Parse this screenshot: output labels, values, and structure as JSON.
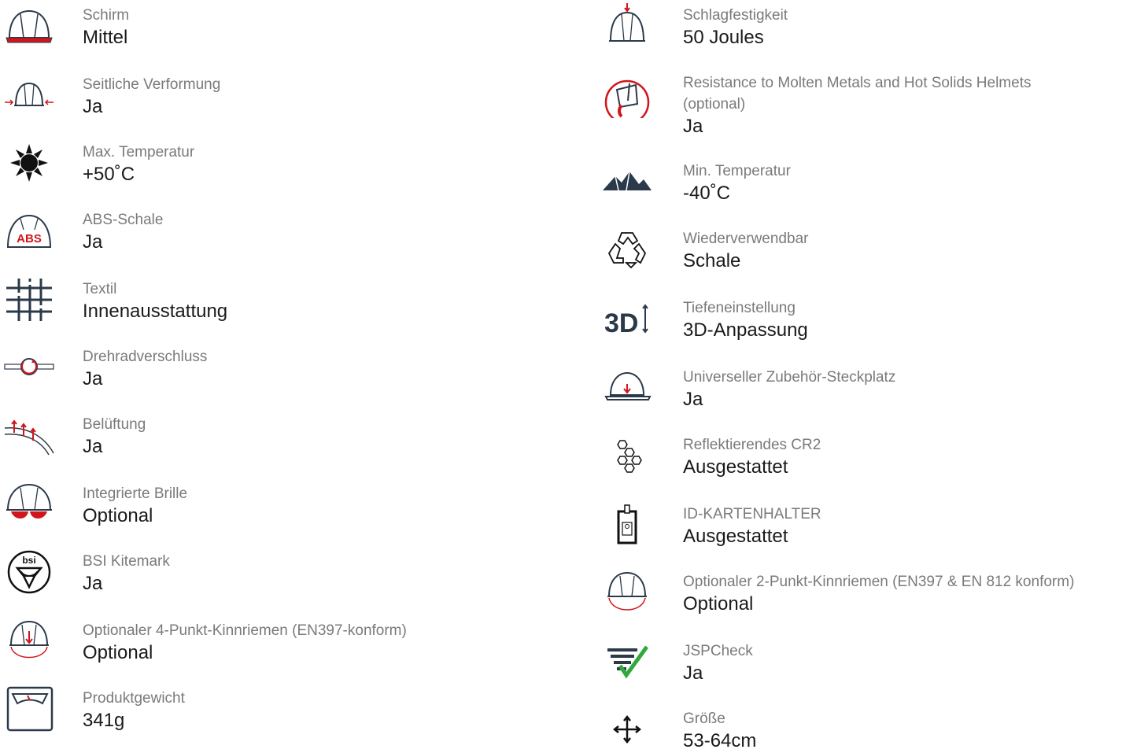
{
  "colors": {
    "accent": "#d0161c",
    "icon": "#2b3a4a",
    "label": "#7a7a7a",
    "value": "#1a1a1a",
    "check": "#2faa3a"
  },
  "left": [
    {
      "icon": "helmet-peak-icon",
      "label": "Schirm",
      "value": "Mittel"
    },
    {
      "icon": "lateral-deformation-icon",
      "label": "Seitliche Verformung",
      "value": "Ja"
    },
    {
      "icon": "sun-heat-icon",
      "label": "Max. Temperatur",
      "value": "+50˚C"
    },
    {
      "icon": "abs-shell-icon",
      "label": "ABS-Schale",
      "value": "Ja"
    },
    {
      "icon": "textile-icon",
      "label": "Textil",
      "value": "Innenausstattung"
    },
    {
      "icon": "wheel-ratchet-icon",
      "label": "Drehradverschluss",
      "value": "Ja"
    },
    {
      "icon": "ventilation-icon",
      "label": "Belüftung",
      "value": "Ja"
    },
    {
      "icon": "integrated-glasses-icon",
      "label": "Integrierte Brille",
      "value": "Optional"
    },
    {
      "icon": "bsi-kitemark-icon",
      "label": "BSI Kitemark",
      "value": "Ja"
    },
    {
      "icon": "four-point-chinstrap-icon",
      "label": "Optionaler 4-Punkt-Kinnriemen (EN397-konform)",
      "value": "Optional"
    },
    {
      "icon": "weight-scale-icon",
      "label": "Produktgewicht",
      "value": "341g"
    }
  ],
  "right": [
    {
      "icon": "impact-resistance-icon",
      "label": "Schlagfestigkeit",
      "value": "50 Joules"
    },
    {
      "icon": "molten-metal-icon",
      "label": "Resistance to Molten Metals and Hot Solids Helmets",
      "label2": "(optional)",
      "value": "Ja"
    },
    {
      "icon": "mountains-cold-icon",
      "label": "Min. Temperatur",
      "value": "-40˚C"
    },
    {
      "icon": "recycle-icon",
      "label": "Wiederverwendbar",
      "value": "Schale"
    },
    {
      "icon": "3d-adjust-icon",
      "label": "Tiefeneinstellung",
      "value": "3D-Anpassung"
    },
    {
      "icon": "accessory-slot-icon",
      "label": "Universeller Zubehör-Steckplatz",
      "value": "Ja"
    },
    {
      "icon": "reflective-hexagon-icon",
      "label": "Reflektierendes CR2",
      "value": "Ausgestattet"
    },
    {
      "icon": "id-card-holder-icon",
      "label": "ID-KARTENHALTER",
      "value": "Ausgestattet"
    },
    {
      "icon": "two-point-chinstrap-icon",
      "label": "Optionaler 2-Punkt-Kinnriemen (EN397 & EN 812 konform)",
      "value": "Optional"
    },
    {
      "icon": "jspcheck-icon",
      "label": "JSPCheck",
      "value": "Ja"
    },
    {
      "icon": "size-adjust-icon",
      "label": "Größe",
      "value": "53-64cm"
    }
  ]
}
